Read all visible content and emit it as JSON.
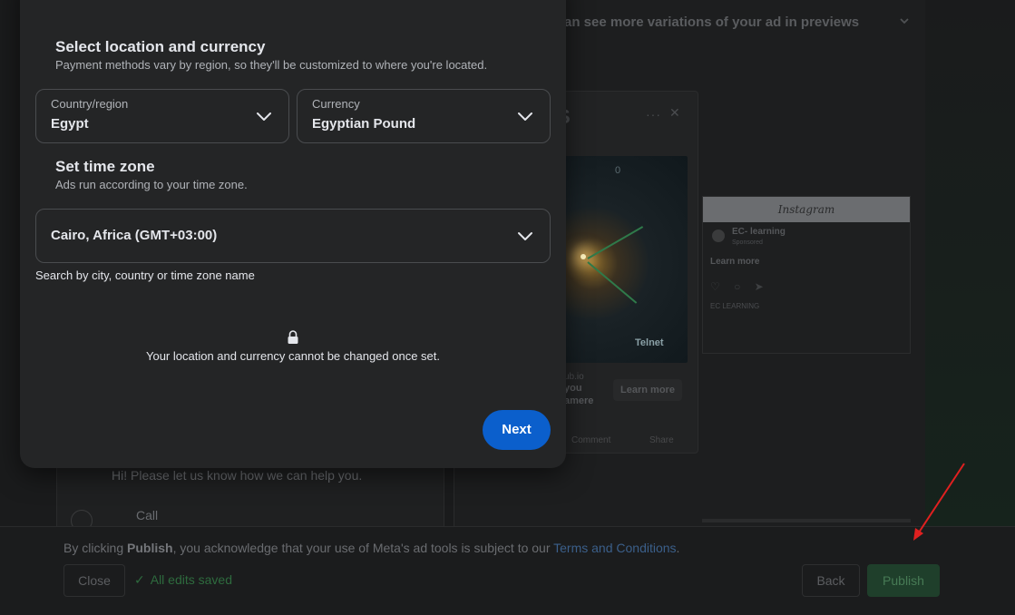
{
  "background": {
    "variations_heading": "an see more variations of your ad in previews",
    "ad_preview": {
      "letter": "S",
      "image_text": "Telnet",
      "image_number": "0",
      "url_fragment": "ub.io",
      "line1": "you",
      "line2": "amere",
      "learn_more": "Learn more",
      "comment": "Comment",
      "share": "Share"
    },
    "instagram_preview": {
      "header": "Instagram",
      "account": "EC- learning",
      "sponsored": "Sponsored",
      "learn_more": "Learn more",
      "caption": "EC LEARNING"
    },
    "help_text": "Hi! Please let us know how we can help you.",
    "call_option": "Call"
  },
  "footer": {
    "legal_prefix": "By clicking ",
    "legal_bold": "Publish",
    "legal_middle": ", you acknowledge that your use of Meta's ad tools is subject to our ",
    "legal_link": "Terms and Conditions",
    "legal_suffix": ".",
    "close_label": "Close",
    "saved_check": "✓",
    "saved_label": "All edits saved",
    "back_label": "Back",
    "publish_label": "Publish"
  },
  "modal": {
    "location_title": "Select location and currency",
    "location_subtitle": "Payment methods vary by region, so they'll be customized to where you're located.",
    "country": {
      "label": "Country/region",
      "value": "Egypt"
    },
    "currency": {
      "label": "Currency",
      "value": "Egyptian Pound"
    },
    "timezone_title": "Set time zone",
    "timezone_subtitle": "Ads run according to your time zone.",
    "timezone": {
      "value": "Cairo, Africa (GMT+03:00)"
    },
    "timezone_hint": "Search by city, country or time zone name",
    "lock_note": "Your location and currency cannot be changed once set.",
    "next_label": "Next"
  },
  "colors": {
    "primary_button": "#0b5fcc",
    "modal_bg": "#242526",
    "annotation_arrow": "#e02020"
  }
}
